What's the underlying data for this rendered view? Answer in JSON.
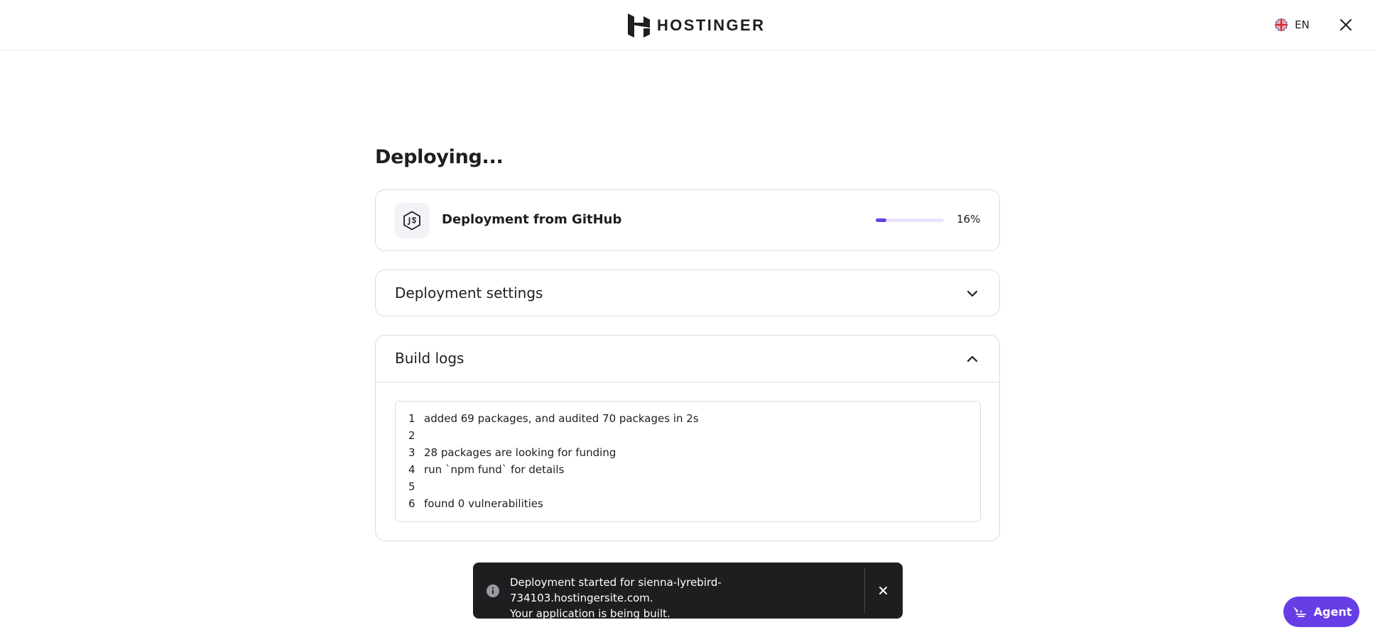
{
  "header": {
    "brand": "HOSTINGER",
    "language_code": "EN",
    "icons": {
      "logo": "hostinger-logo-icon",
      "language": "uk-flag-icon",
      "close": "close-icon"
    }
  },
  "main": {
    "title": "Deploying...",
    "deployment": {
      "source_label": "Deployment from GitHub",
      "icon": "nodejs-icon",
      "progress": 0.16,
      "progress_text": "16%"
    },
    "settings": {
      "title": "Deployment settings",
      "expanded": false,
      "icon": "chevron-down-icon"
    },
    "build_logs": {
      "title": "Build logs",
      "expanded": true,
      "icon": "chevron-up-icon",
      "lines": [
        {
          "n": "1",
          "text": "added 69 packages, and audited 70 packages in 2s"
        },
        {
          "n": "2",
          "text": ""
        },
        {
          "n": "3",
          "text": "28 packages are looking for funding"
        },
        {
          "n": "4",
          "text": "run `npm fund` for details"
        },
        {
          "n": "5",
          "text": ""
        },
        {
          "n": "6",
          "text": "found 0 vulnerabilities"
        }
      ]
    }
  },
  "toast": {
    "line1": "Deployment started for sienna-lyrebird-734103.hostingersite.com.",
    "line2": "Your application is being built.",
    "icons": {
      "info": "info-icon",
      "close": "close-icon"
    }
  },
  "agent_button": {
    "label": "Agent",
    "icon": "agent-sparkle-icon"
  },
  "colors": {
    "accent": "#673de6",
    "accent_light": "#ebe4ff",
    "text": "#1d1e20",
    "border": "#dadce0",
    "toast_bg": "#1d1e20"
  }
}
